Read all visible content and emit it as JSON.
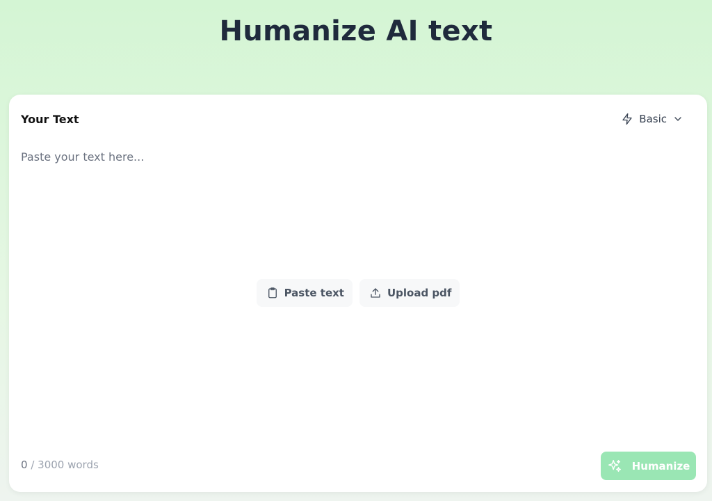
{
  "page": {
    "title": "Humanize AI text"
  },
  "editor": {
    "label": "Your Text",
    "placeholder": "Paste your text here...",
    "value": ""
  },
  "mode": {
    "selected": "Basic",
    "icon": "lightning-icon"
  },
  "actions": {
    "paste_label": "Paste text",
    "paste_icon": "clipboard-icon",
    "upload_label": "Upload pdf",
    "upload_icon": "upload-icon"
  },
  "footer": {
    "word_count_current": "0",
    "word_count_suffix": "/ 3000 words",
    "humanize_label": "Humanize",
    "humanize_icon": "sparkles-icon"
  },
  "colors": {
    "accent": "#9ae6b4",
    "background": "#d4f5d4",
    "title": "#1f2a3c"
  }
}
